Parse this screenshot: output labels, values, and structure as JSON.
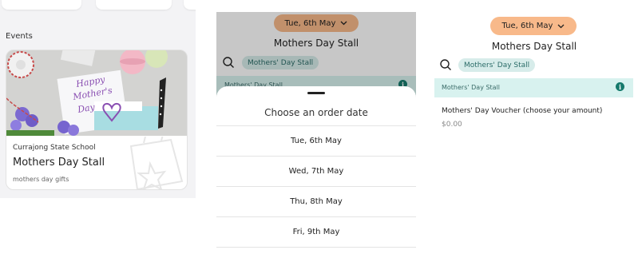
{
  "panel1": {
    "events_label": "Events",
    "card": {
      "school": "Currajong State School",
      "title": "Mothers Day Stall",
      "subtitle": "mothers day gifts",
      "image_text": "Happy Mother's Day"
    }
  },
  "panel2": {
    "date_pill": "Tue, 6th May",
    "stall_title": "Mothers Day Stall",
    "chip": "Mothers' Day Stall",
    "band_label": "Mothers' Day Stall",
    "sheet": {
      "title": "Choose an order date",
      "dates": [
        "Tue, 6th May",
        "Wed, 7th May",
        "Thu, 8th May",
        "Fri, 9th May"
      ]
    }
  },
  "panel3": {
    "date_pill": "Tue, 6th May",
    "stall_title": "Mothers Day Stall",
    "chip": "Mothers' Day Stall",
    "band_label": "Mothers' Day Stall",
    "product": "Mothers' Day Voucher (choose your amount)",
    "price": "$0.00"
  },
  "colors": {
    "pill": "#f8b98a",
    "chip_bg": "#d7ecea",
    "band_bg": "#d8f2ef",
    "info_icon": "#167a6c"
  },
  "icons": [
    "chevron-down-icon",
    "search-icon",
    "info-icon"
  ]
}
